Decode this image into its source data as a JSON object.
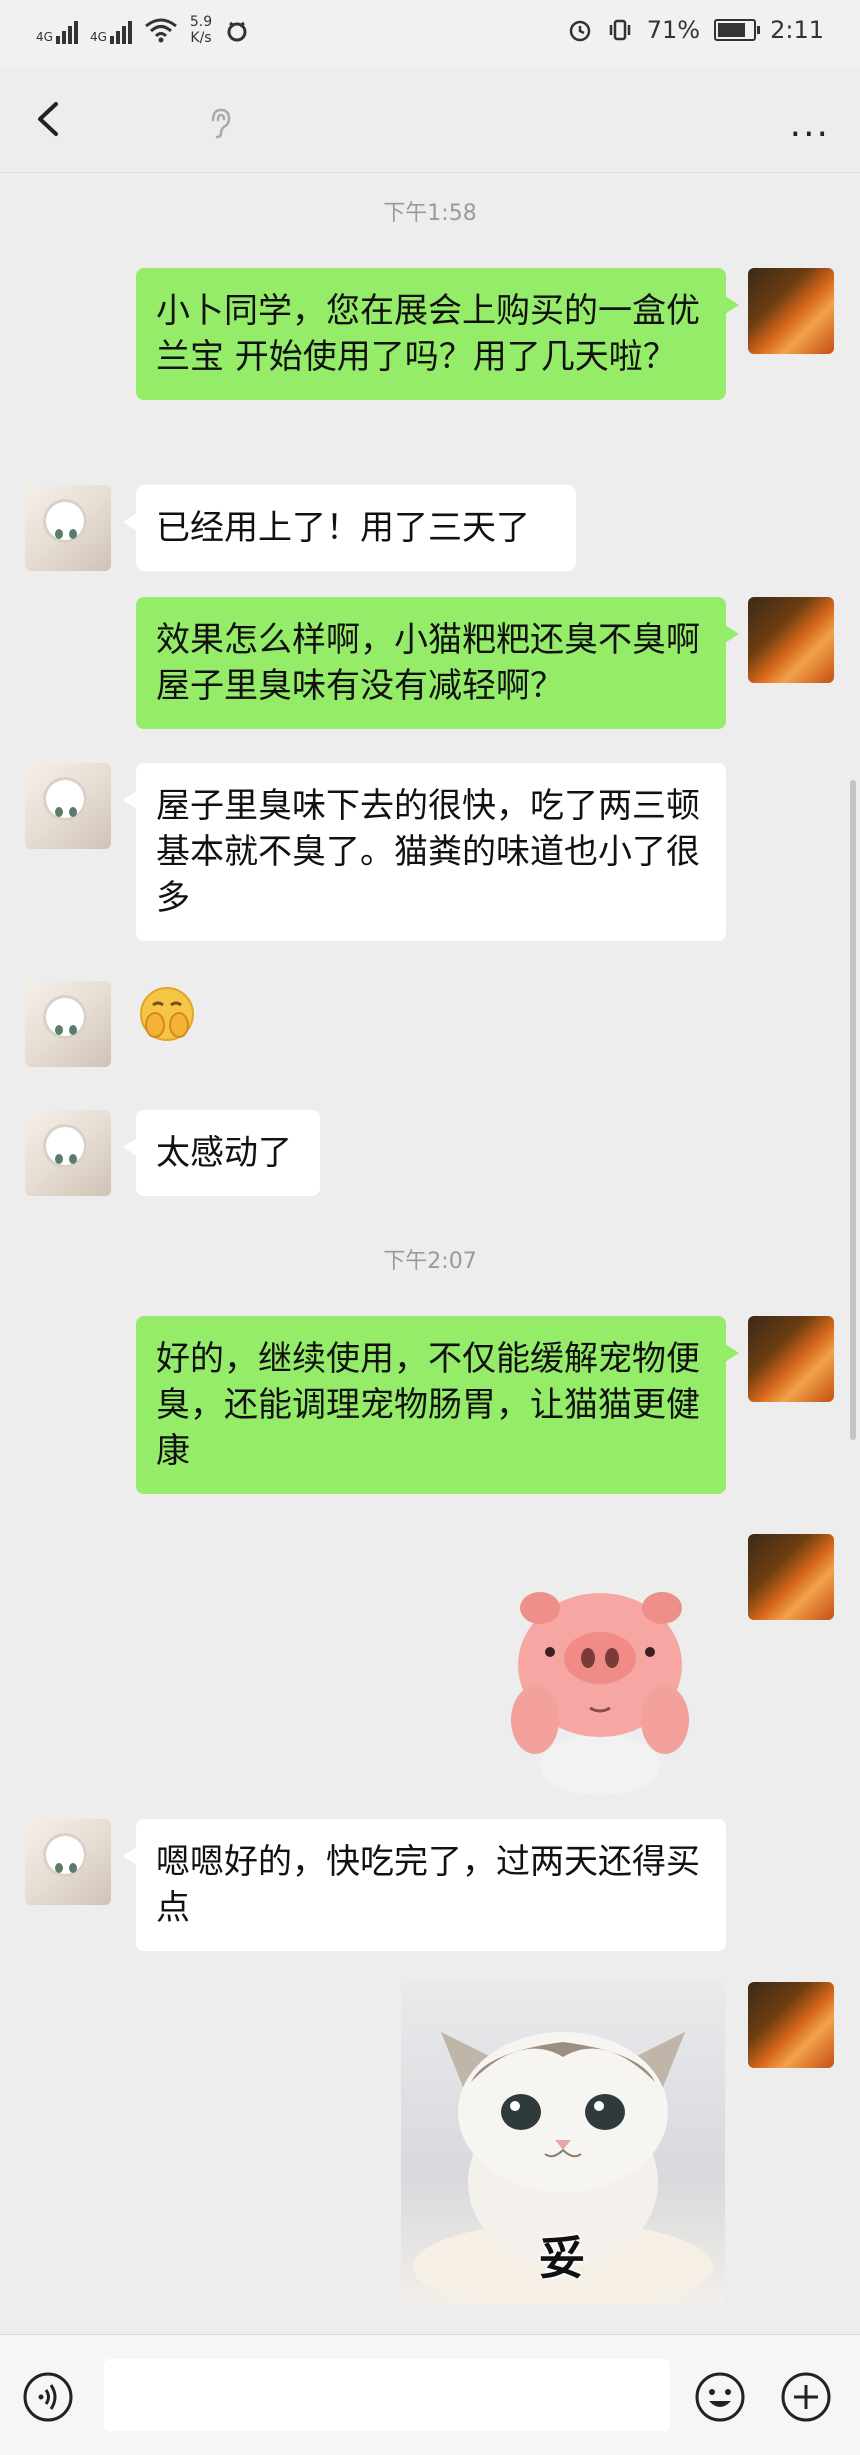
{
  "status_bar": {
    "signal1": "4G",
    "signal2": "4G",
    "speed_value": "5.9",
    "speed_unit": "K/s",
    "battery": "71%",
    "time": "2:11"
  },
  "nav": {
    "title": "",
    "more": "···"
  },
  "messages": [
    {
      "type": "time",
      "text": "下午1:58"
    },
    {
      "type": "text",
      "side": "me",
      "text": "小卜同学，您在展会上购买的一盒优兰宝 开始使用了吗？用了几天啦？"
    },
    {
      "type": "text",
      "side": "other",
      "text": "已经用上了！用了三天了"
    },
    {
      "type": "text",
      "side": "me",
      "text": "效果怎么样啊，小猫粑粑还臭不臭啊 屋子里臭味有没有减轻啊？"
    },
    {
      "type": "text",
      "side": "other",
      "text": "屋子里臭味下去的很快，吃了两三顿基本就不臭了。猫粪的味道也小了很多"
    },
    {
      "type": "emoji",
      "side": "other",
      "icon": "covering-mouth-emoji-icon"
    },
    {
      "type": "text",
      "side": "other",
      "text": "太感动了"
    },
    {
      "type": "time",
      "text": "下午2:07"
    },
    {
      "type": "text",
      "side": "me",
      "text": "好的，继续使用，不仅能缓解宠物便臭，还能调理宠物肠胃，让猫猫更健康"
    },
    {
      "type": "sticker",
      "side": "me",
      "icon": "pig-sticker-icon"
    },
    {
      "type": "text",
      "side": "other",
      "text": "嗯嗯好的，快吃完了，过两天还得买点"
    },
    {
      "type": "sticker",
      "side": "me",
      "icon": "kitten-sticker-icon",
      "caption": "妥"
    }
  ],
  "input_bar": {
    "placeholder": "",
    "voice_icon": "voice-icon",
    "emoji_icon": "smiley-icon",
    "plus_icon": "plus-icon"
  },
  "colors": {
    "my_bubble": "#95ec69",
    "other_bubble": "#ffffff",
    "background": "#ededed"
  }
}
